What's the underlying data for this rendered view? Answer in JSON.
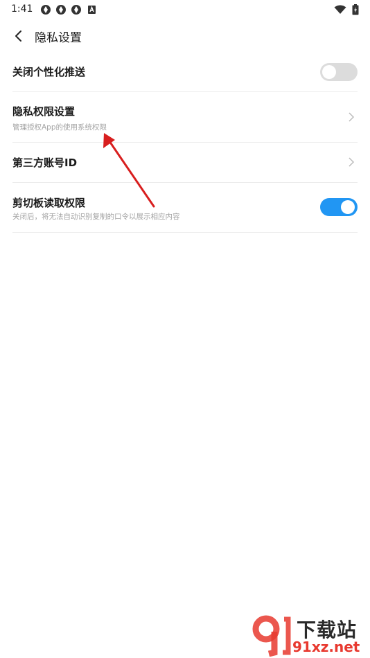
{
  "status_bar": {
    "time": "1:41",
    "left_icons": [
      "sync-icon",
      "sync-icon",
      "sync-icon",
      "app-badge-icon"
    ],
    "right_icons": [
      "wifi-icon",
      "battery-charging-icon"
    ]
  },
  "header": {
    "back_icon": "chevron-left-icon",
    "title": "隐私设置"
  },
  "settings": {
    "personalized_push": {
      "title": "关闭个性化推送",
      "toggle_on": false
    },
    "privacy_permissions": {
      "title": "隐私权限设置",
      "subtitle": "管理授权App的使用系统权限"
    },
    "third_party_account": {
      "title": "第三方账号ID"
    },
    "clipboard": {
      "title": "剪切板读取权限",
      "subtitle": "关闭后，将无法自动识别复制的口令以展示相应内容",
      "toggle_on": true
    }
  },
  "colors": {
    "toggle_on": "#2196f3",
    "toggle_off": "#dcdcdc",
    "annotation_arrow": "#d81e1e",
    "watermark_red": "#e8392f"
  },
  "watermark": {
    "top_text": "下载站",
    "bottom_text": "91xz.net"
  }
}
